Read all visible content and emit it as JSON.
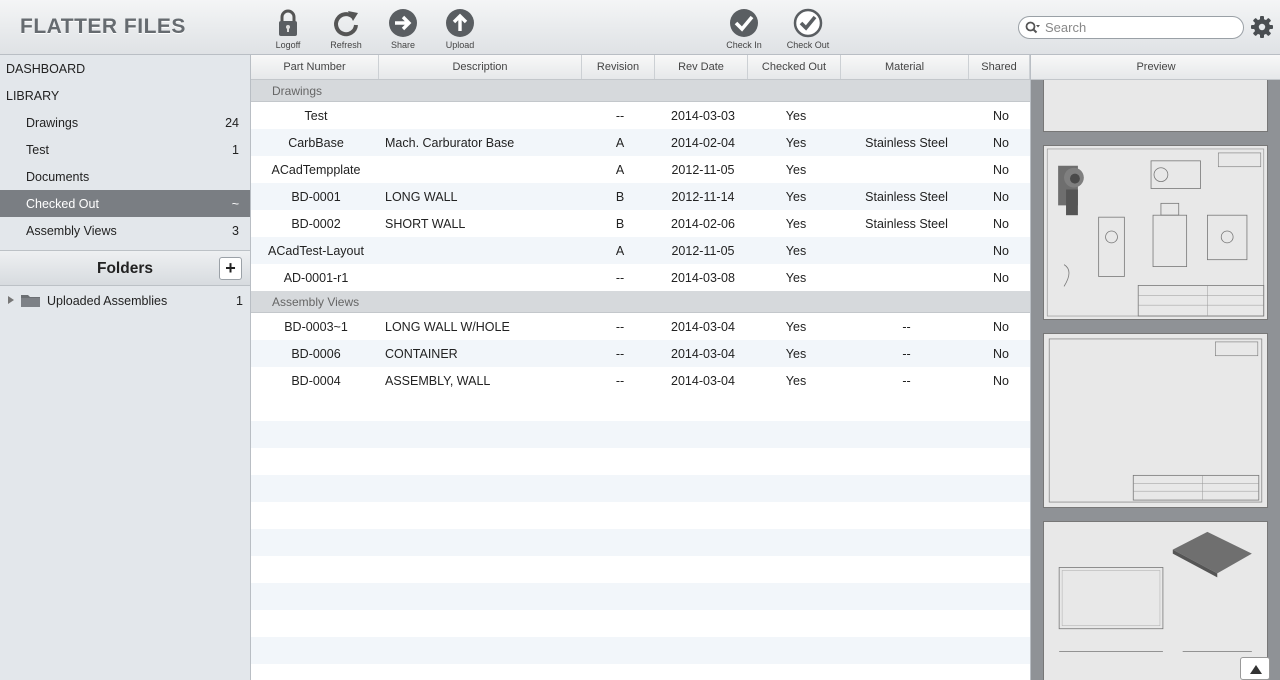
{
  "app": {
    "title": "FLATTER FILES"
  },
  "toolbar": {
    "logoff": "Logoff",
    "refresh": "Refresh",
    "share": "Share",
    "upload": "Upload",
    "check_in": "Check In",
    "check_out": "Check Out"
  },
  "search": {
    "placeholder": "Search",
    "value": ""
  },
  "sidebar": {
    "dashboard": "DASHBOARD",
    "library": "LIBRARY",
    "items": [
      {
        "label": "Drawings",
        "count": "24"
      },
      {
        "label": "Test",
        "count": "1"
      },
      {
        "label": "Documents",
        "count": ""
      },
      {
        "label": "Checked Out",
        "count": "~"
      },
      {
        "label": "Assembly Views",
        "count": "3"
      }
    ],
    "active_index": 3,
    "folders_title": "Folders",
    "add_folder": "+",
    "folders": [
      {
        "label": "Uploaded Assemblies",
        "count": "1"
      }
    ]
  },
  "table": {
    "columns": [
      "Part Number",
      "Description",
      "Revision",
      "Rev Date",
      "Checked Out",
      "Material",
      "Shared"
    ],
    "groups": [
      {
        "name": "Drawings",
        "rows": [
          {
            "part": "Test",
            "desc": "",
            "rev": "--",
            "date": "2014-03-03",
            "checked": "Yes",
            "material": "",
            "shared": "No"
          },
          {
            "part": "CarbBase",
            "desc": "Mach. Carburator Base",
            "rev": "A",
            "date": "2014-02-04",
            "checked": "Yes",
            "material": "Stainless Steel",
            "shared": "No"
          },
          {
            "part": "ACadTempplate",
            "desc": "",
            "rev": "A",
            "date": "2012-11-05",
            "checked": "Yes",
            "material": "",
            "shared": "No"
          },
          {
            "part": "BD-0001",
            "desc": "LONG WALL",
            "rev": "B",
            "date": "2012-11-14",
            "checked": "Yes",
            "material": "Stainless Steel",
            "shared": "No"
          },
          {
            "part": "BD-0002",
            "desc": "SHORT WALL",
            "rev": "B",
            "date": "2014-02-06",
            "checked": "Yes",
            "material": "Stainless Steel",
            "shared": "No"
          },
          {
            "part": "ACadTest-Layout",
            "desc": "",
            "rev": "A",
            "date": "2012-11-05",
            "checked": "Yes",
            "material": "",
            "shared": "No"
          },
          {
            "part": "AD-0001-r1",
            "desc": "",
            "rev": "--",
            "date": "2014-03-08",
            "checked": "Yes",
            "material": "",
            "shared": "No"
          }
        ]
      },
      {
        "name": "Assembly Views",
        "rows": [
          {
            "part": "BD-0003~1",
            "desc": "LONG WALL W/HOLE",
            "rev": "--",
            "date": "2014-03-04",
            "checked": "Yes",
            "material": "--",
            "shared": "No"
          },
          {
            "part": "BD-0006",
            "desc": "CONTAINER",
            "rev": "--",
            "date": "2014-03-04",
            "checked": "Yes",
            "material": "--",
            "shared": "No"
          },
          {
            "part": "BD-0004",
            "desc": "ASSEMBLY, WALL",
            "rev": "--",
            "date": "2014-03-04",
            "checked": "Yes",
            "material": "--",
            "shared": "No"
          }
        ]
      }
    ]
  },
  "preview": {
    "title": "Preview"
  },
  "icons": {
    "logoff": "lock-icon",
    "refresh": "refresh-icon",
    "share": "share-arrow-icon",
    "upload": "upload-arrow-icon",
    "check_in": "check-in-icon",
    "check_out": "check-out-icon",
    "search": "search-icon",
    "settings": "gear-icon",
    "folder": "folder-icon"
  },
  "colors": {
    "active_nav": "#7a7e83",
    "row_stripe": "#f2f6fa",
    "group_bg": "#d6d9dc"
  }
}
